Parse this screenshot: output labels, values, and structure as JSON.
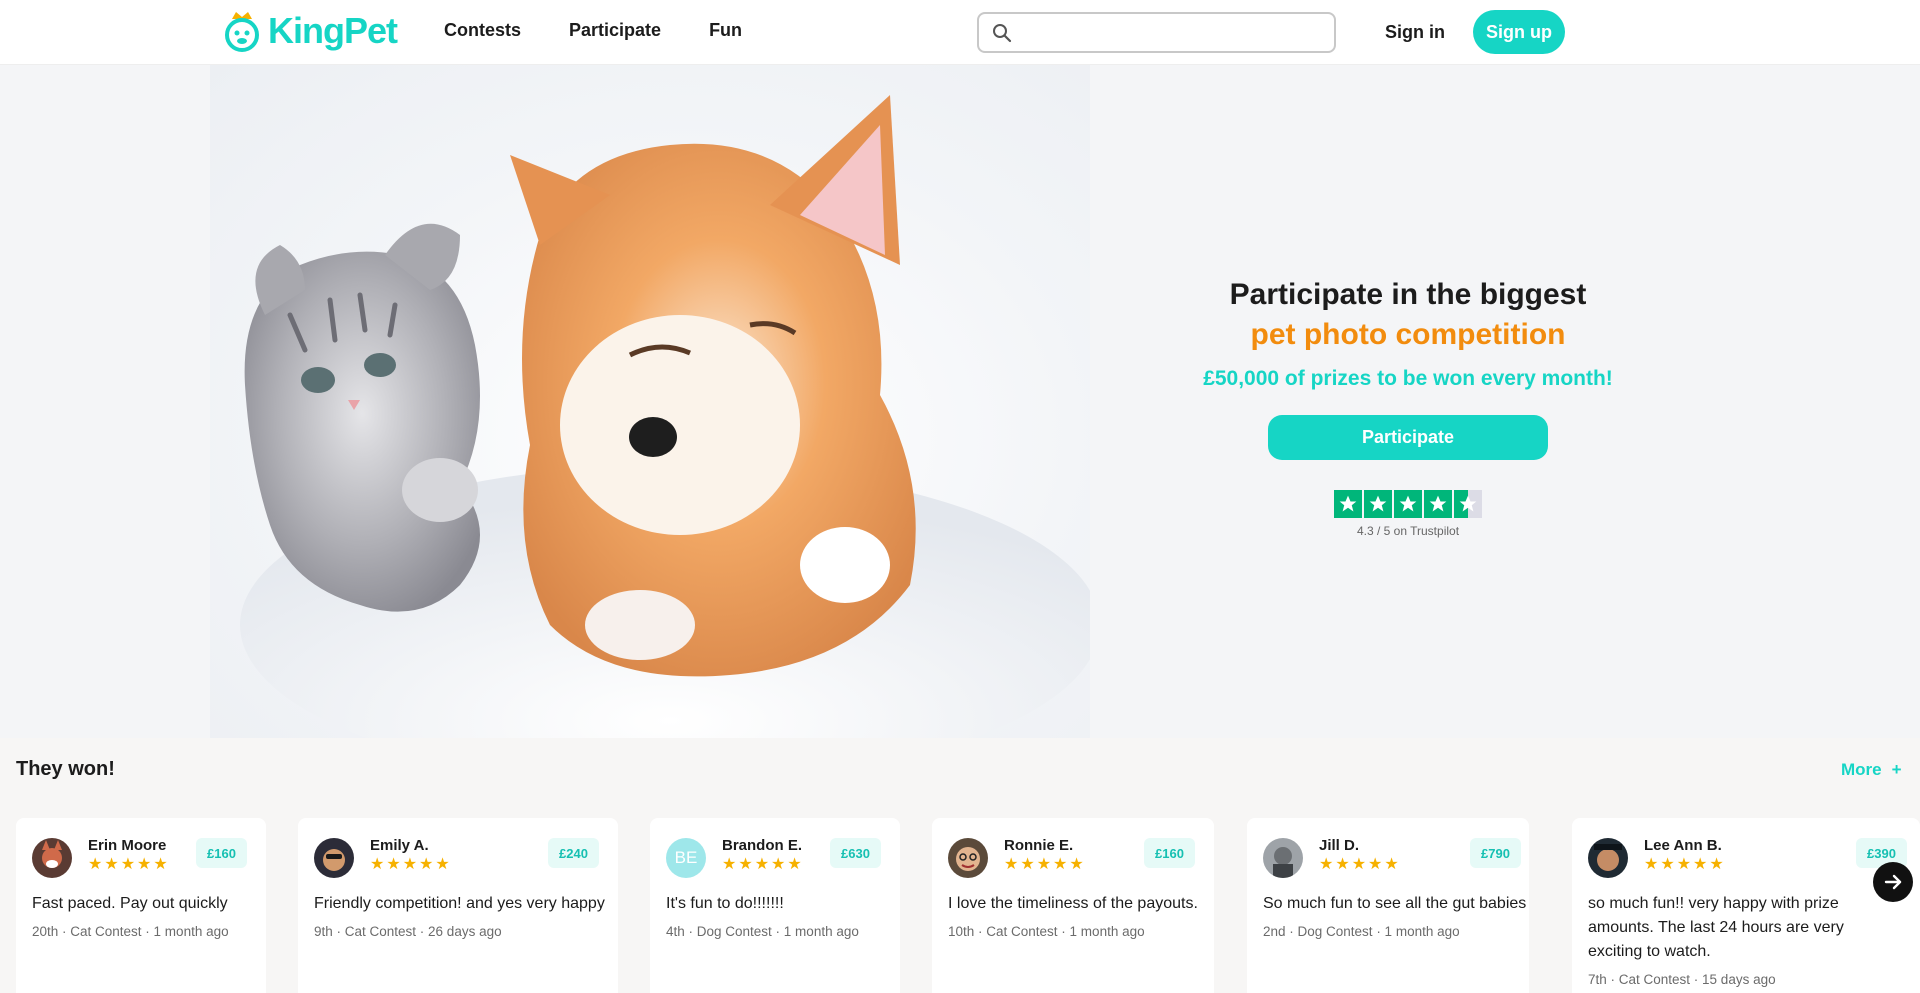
{
  "header": {
    "logo_text": "KingPet",
    "nav": [
      "Contests",
      "Participate",
      "Fun"
    ],
    "search_placeholder": "",
    "signin_label": "Sign in",
    "signup_label": "Sign up"
  },
  "hero": {
    "title_line1": "Participate in the biggest",
    "title_line2": "pet photo competition",
    "prize_text": "£50,000 of prizes to be won every month!",
    "cta_label": "Participate",
    "trustpilot": {
      "rating": 4.3,
      "text": "4.3 / 5 on Trustpilot"
    }
  },
  "winners": {
    "title": "They won!",
    "more_label": "More",
    "more_icon": "+",
    "cards": [
      {
        "name": "Erin Moore",
        "prize": "£160",
        "stars": 5,
        "review": "Fast paced. Pay out quickly",
        "meta": "20th · Cat Contest · 1 month ago",
        "avatar": "photo"
      },
      {
        "name": "Emily A.",
        "prize": "£240",
        "stars": 5,
        "review": "Friendly competition! and yes very happy",
        "meta": "9th · Cat Contest · 26 days ago",
        "avatar": "photo"
      },
      {
        "name": "Brandon E.",
        "prize": "£630",
        "stars": 5,
        "review": "It's fun to do!!!!!!!",
        "meta": "4th · Dog Contest · 1 month ago",
        "avatar": "BE"
      },
      {
        "name": "Ronnie E.",
        "prize": "£160",
        "stars": 5,
        "review": "I love the timeliness of the payouts.",
        "meta": "10th · Cat Contest · 1 month ago",
        "avatar": "photo"
      },
      {
        "name": "Jill D.",
        "prize": "£790",
        "stars": 5,
        "review": "So much fun to see all the gut babies",
        "meta": "2nd · Dog Contest · 1 month ago",
        "avatar": "photo"
      },
      {
        "name": "Lee Ann B.",
        "prize": "£390",
        "stars": 5,
        "review": "so much fun!! very happy with prize amounts. The last 24 hours are very exciting to watch.",
        "meta": "7th · Cat Contest · 15 days ago",
        "avatar": "photo"
      }
    ]
  },
  "colors": {
    "brand": "#16d5c5",
    "accent_orange": "#f28c0e",
    "trustpilot_green": "#00b67a",
    "star_yellow": "#f6b100"
  }
}
